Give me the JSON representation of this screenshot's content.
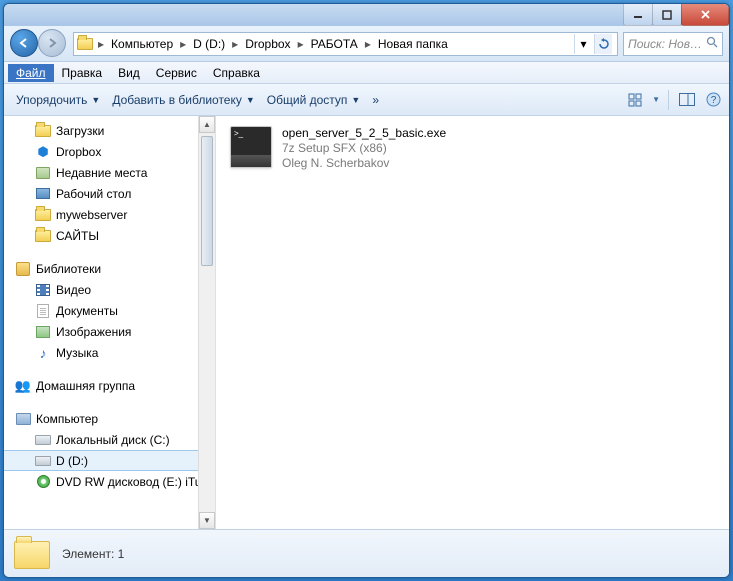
{
  "window_controls": {
    "minimize": "minimize",
    "maximize": "maximize",
    "close": "close"
  },
  "breadcrumb": {
    "items": [
      "Компьютер",
      "D (D:)",
      "Dropbox",
      "РАБОТА",
      "Новая папка"
    ]
  },
  "search": {
    "placeholder": "Поиск: Нов…"
  },
  "menu": {
    "file": "Файл",
    "edit": "Правка",
    "view": "Вид",
    "tools": "Сервис",
    "help": "Справка"
  },
  "toolbar": {
    "organize": "Упорядочить",
    "addlib": "Добавить в библиотеку",
    "share": "Общий доступ",
    "overflow": "»"
  },
  "tree": {
    "favorites": {
      "downloads": "Загрузки",
      "dropbox": "Dropbox",
      "recent": "Недавние места",
      "desktop": "Рабочий стол",
      "myweb": "mywebserver",
      "sites": "САЙТЫ"
    },
    "libraries": {
      "label": "Библиотеки",
      "video": "Видео",
      "documents": "Документы",
      "pictures": "Изображения",
      "music": "Музыка"
    },
    "homegroup": "Домашняя группа",
    "computer": {
      "label": "Компьютер",
      "c": "Локальный диск (C:)",
      "d": "D (D:)",
      "dvd": "DVD RW дисковод (E:) iTutc"
    }
  },
  "file": {
    "name": "open_server_5_2_5_basic.exe",
    "type": "7z Setup SFX (x86)",
    "author": "Oleg N. Scherbakov"
  },
  "status": {
    "count_label": "Элемент: 1"
  }
}
